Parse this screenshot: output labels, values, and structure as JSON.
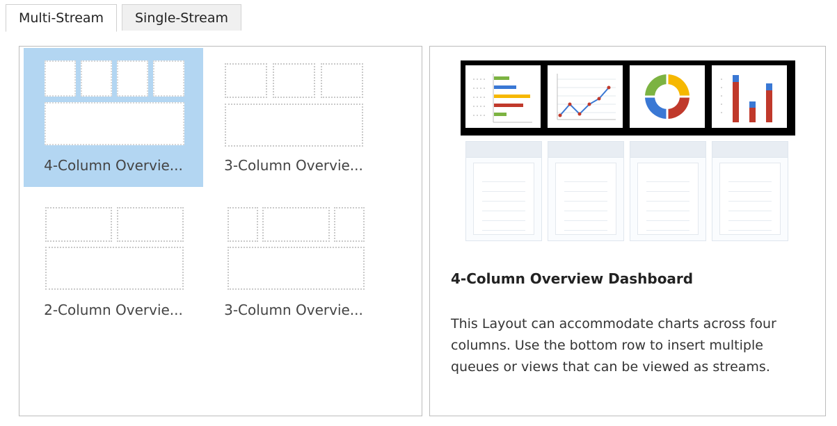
{
  "tabs": [
    {
      "label": "Multi-Stream",
      "active": true
    },
    {
      "label": "Single-Stream",
      "active": false
    }
  ],
  "layouts": [
    {
      "label": "4-Column Overvie...",
      "selected": true
    },
    {
      "label": "3-Column Overvie...",
      "selected": false
    },
    {
      "label": "2-Column Overvie...",
      "selected": false
    },
    {
      "label": "3-Column Overvie...",
      "selected": false
    }
  ],
  "details": {
    "title": "4-Column Overview Dashboard",
    "description": "This Layout can accommodate charts across four columns. Use the bottom row to insert multiple queues or views that can be viewed as streams."
  },
  "colors": {
    "selected_bg": "#b3d6f2",
    "chart_green": "#7cb342",
    "chart_blue": "#3a78d4",
    "chart_orange": "#f6b800",
    "chart_red": "#c0392b"
  },
  "preview_icons": [
    "bar-chart-icon",
    "line-chart-icon",
    "donut-chart-icon",
    "column-chart-icon"
  ]
}
